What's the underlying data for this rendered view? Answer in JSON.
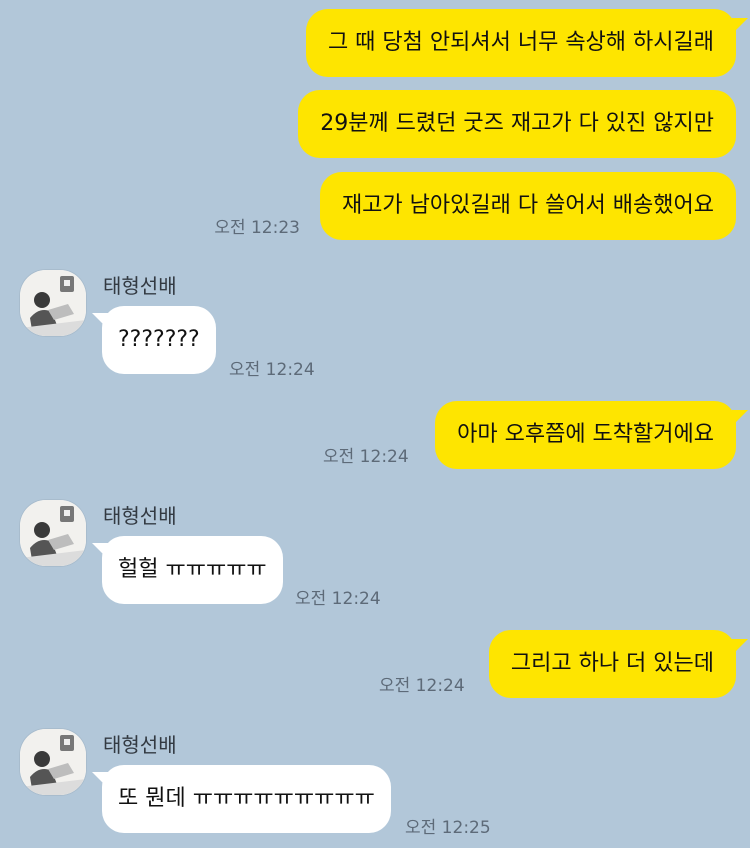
{
  "colors": {
    "background": "#b2c7d9",
    "my_bubble": "#fee500",
    "other_bubble": "#ffffff",
    "timestamp": "#5d6a78"
  },
  "messages": [
    {
      "from": "me",
      "text": "그 때 당첨 안되셔서 너무 속상해 하시길래"
    },
    {
      "from": "me",
      "text": "29분께 드렸던 굿즈 재고가 다 있진 않지만"
    },
    {
      "from": "me",
      "text": "재고가 남아있길래 다 쓸어서 배송했어요",
      "time": "오전 12:23"
    },
    {
      "from": "other",
      "sender": "태형선배",
      "text": "???????",
      "time": "오전 12:24"
    },
    {
      "from": "me",
      "text": "아마 오후쯤에 도착할거에요",
      "time": "오전 12:24"
    },
    {
      "from": "other",
      "sender": "태형선배",
      "text": "헐헐 ㅠㅠㅠㅠㅠ",
      "time": "오전 12:24"
    },
    {
      "from": "me",
      "text": "그리고 하나 더 있는데",
      "time": "오전 12:24"
    },
    {
      "from": "other",
      "sender": "태형선배",
      "text": "또 뭔데 ㅠㅠㅠㅠㅠㅠㅠㅠㅠ",
      "time": "오전 12:25"
    }
  ]
}
